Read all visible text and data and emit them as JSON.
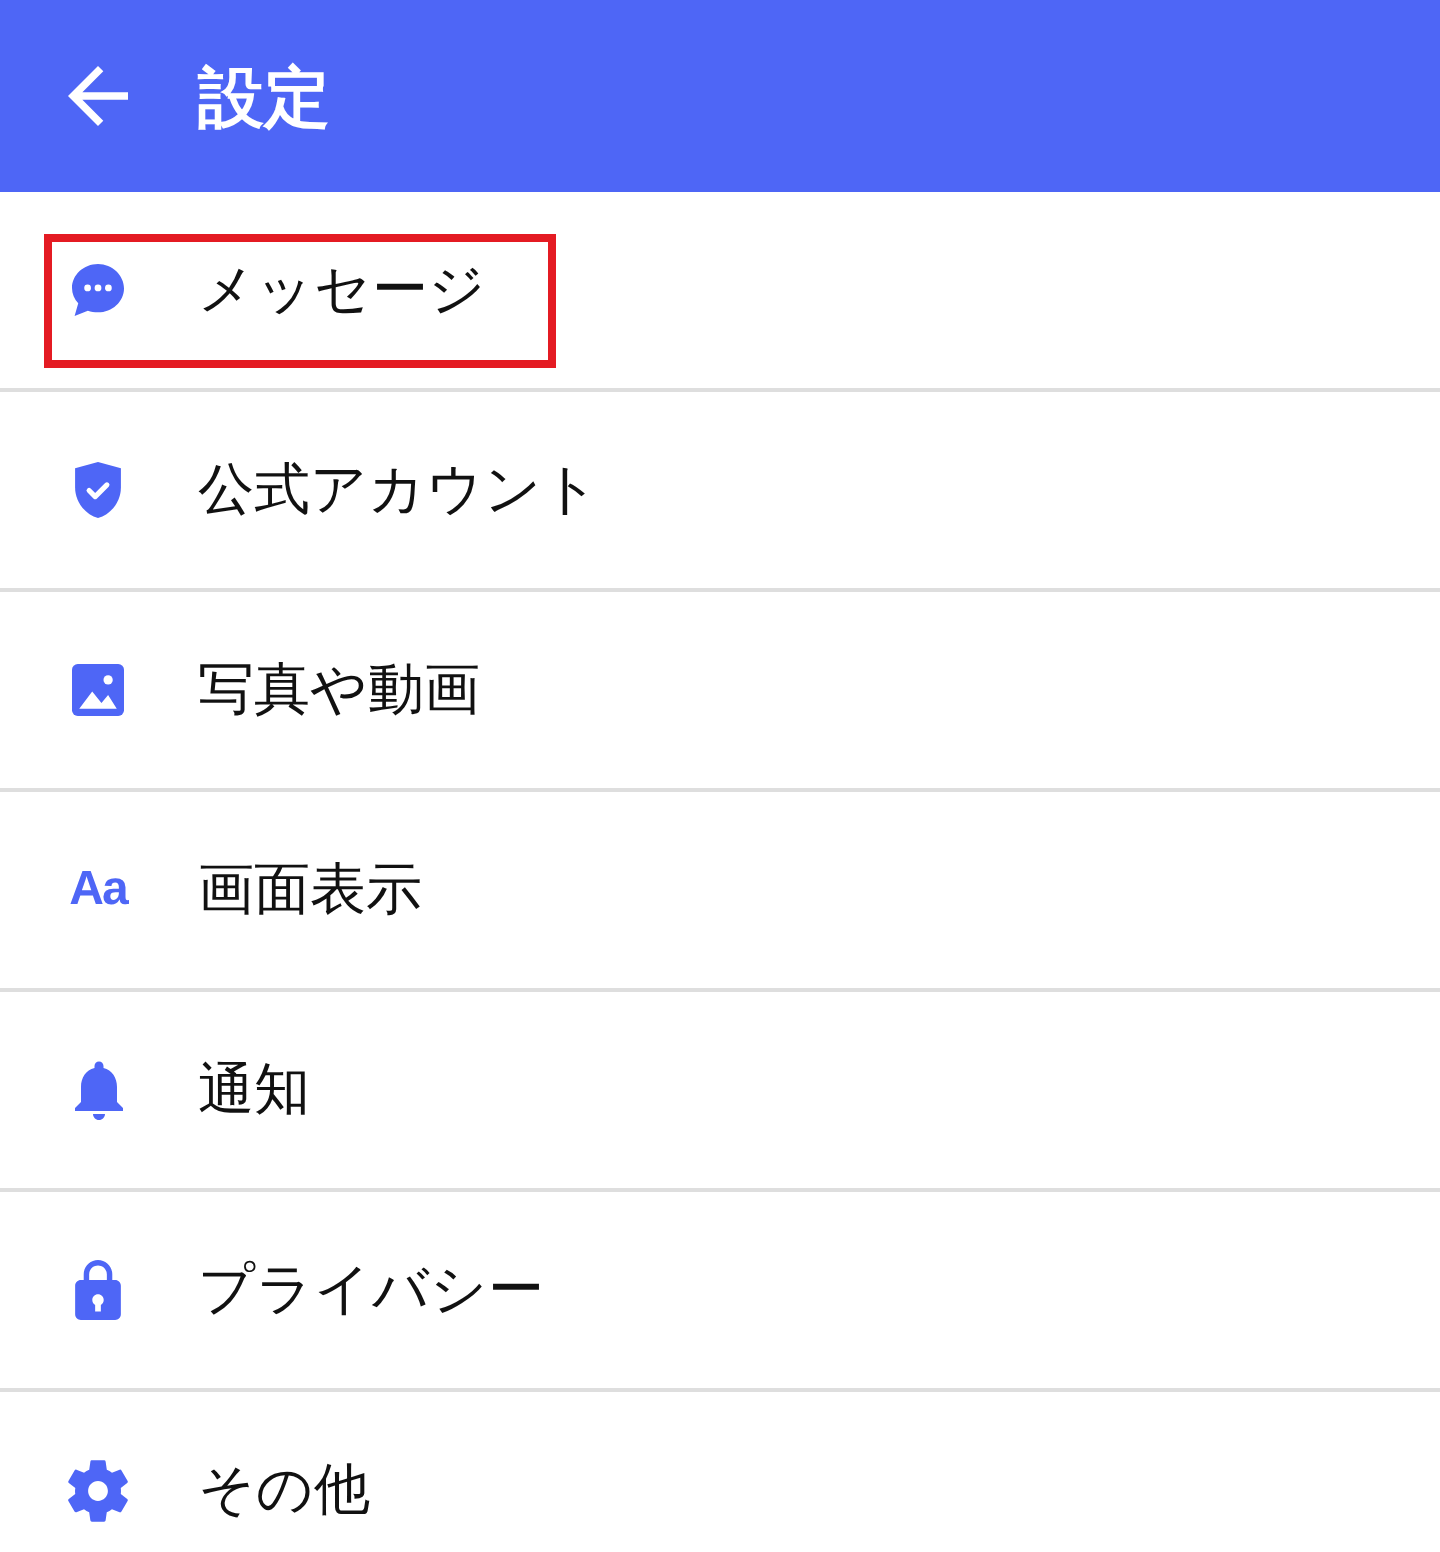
{
  "header": {
    "title": "設定"
  },
  "items": [
    {
      "label": "メッセージ",
      "highlighted": true
    },
    {
      "label": "公式アカウント",
      "highlighted": false
    },
    {
      "label": "写真や動画",
      "highlighted": false
    },
    {
      "label": "画面表示",
      "icon_text": "Aa",
      "highlighted": false
    },
    {
      "label": "通知",
      "highlighted": false
    },
    {
      "label": "プライバシー",
      "highlighted": false
    },
    {
      "label": "その他",
      "highlighted": false
    }
  ]
}
